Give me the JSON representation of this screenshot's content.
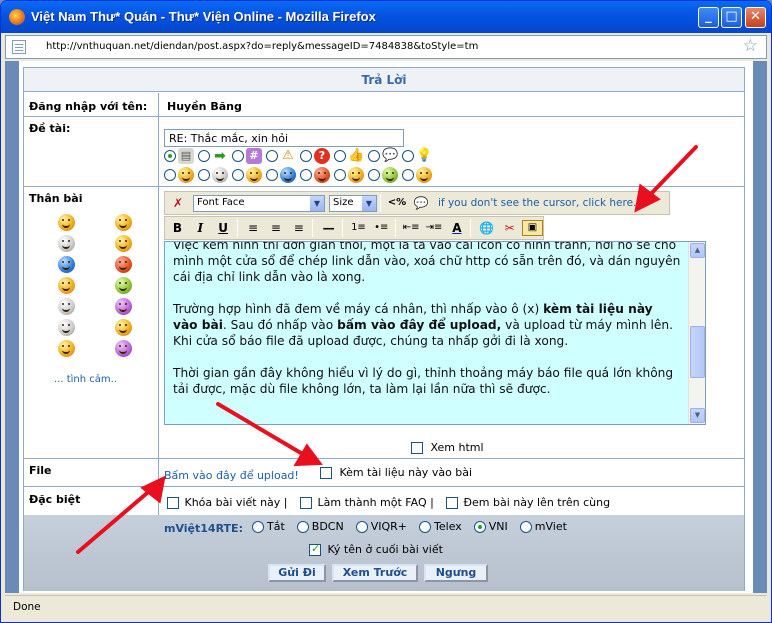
{
  "window": {
    "title": "Việt Nam Thư* Quán - Thư* Viện Online - Mozilla Firefox",
    "minimize": "_",
    "maximize": "□",
    "close": "✕"
  },
  "address": {
    "url": "http://vnthuquan.net/diendan/post.aspx?do=reply&messageID=7484838&toStyle=tm"
  },
  "form": {
    "heading": "Trả Lời",
    "login_label": "Đăng nhập với tên:",
    "login_value": "Huyền Băng",
    "subject_label": "Đề tài:",
    "subject_value": "RE: Thắc mắc, xin hỏi",
    "body_label": "Thân bài",
    "more_emoticons": "... tình cảm..",
    "font_face": "Font Face",
    "font_size": "Size",
    "toolbar_hint": "if you don't see the cursor, click here.",
    "editor": {
      "p1": "Việc kèm hình thì đơn giản thôi, một là ta vào cái icon có hình tranh, nơi nó sẽ cho mình một cửa sổ để chép link dẫn vào, xoá chữ http có sẵn trên đó, và dán nguyên cái địa chỉ link dẫn vào là xong.",
      "p2_a": "Trường hợp hình đã đem về máy cá nhân, thì nhấp vào ô (x) ",
      "p2_b": "kèm tài liệu này vào bài",
      "p2_c": ". Sau đó nhấp vào ",
      "p2_d": "bấm vào đây để upload,",
      "p2_e": " và upload từ máy mình lên. Khi cửa sổ báo file đã upload được, chúng ta nhấp gởi đi là xong.",
      "p3": "Thời gian gần đây không hiểu vì lý do gì, thỉnh thoảng máy báo file quá lớn không tải được, mặc dù file không lớn, ta làm lại lần nữa thì sẽ được."
    },
    "view_html": "Xem html",
    "file_label": "File",
    "upload_link": "Bấm vào đây để upload!",
    "attach_label": "Kèm tài liệu này vào bài",
    "special_label": "Đặc biệt",
    "lock_label": "Khóa bài viết này |",
    "faq_label": "Làm thành một FAQ |",
    "pin_label": "Đem bài này lên trên cùng",
    "rte_label": "mViệt14RTE:",
    "rte_options": [
      "Tắt",
      "BDCN",
      "VIQR+",
      "Telex",
      "VNI",
      "mViet"
    ],
    "rte_selected": "VNI",
    "signature_label": "Ký tên ở cuối bài viết",
    "submit": "Gửi Đi",
    "preview": "Xem Trước",
    "cancel": "Ngưng"
  },
  "status": {
    "text": "Done"
  },
  "colors": {
    "title_bar": "#0553e1",
    "editor_bg": "#cfffff",
    "arrow": "#e8101e",
    "link": "#1a5fa8"
  }
}
